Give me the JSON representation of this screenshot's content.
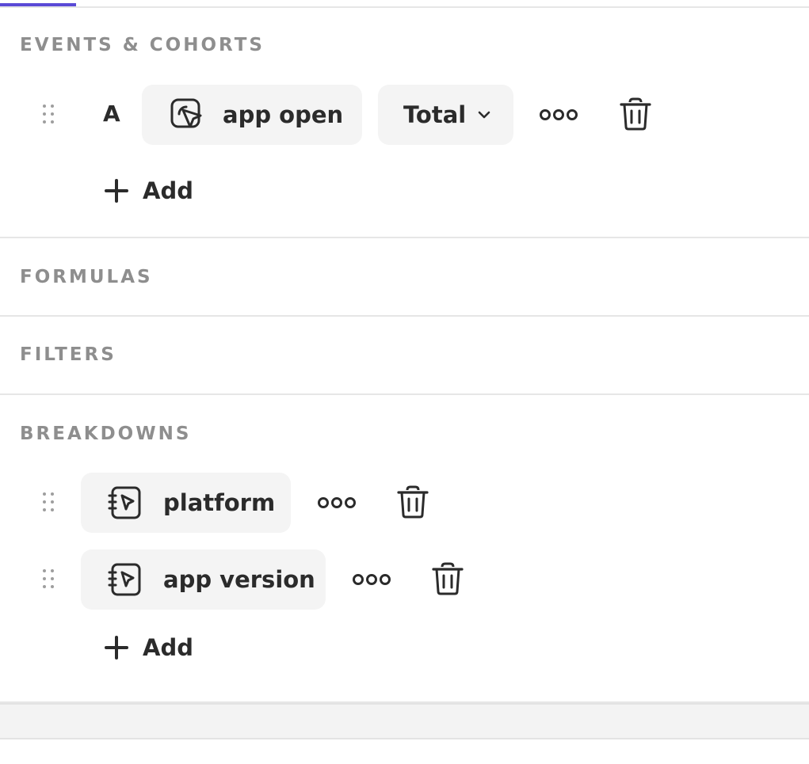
{
  "sections": {
    "events": {
      "title": "EVENTS & COHORTS"
    },
    "formulas": {
      "title": "FORMULAS"
    },
    "filters": {
      "title": "FILTERS"
    },
    "breakdowns": {
      "title": "BREAKDOWNS"
    }
  },
  "events": {
    "rows": [
      {
        "letter": "A",
        "event_label": "app open",
        "aggregation": "Total"
      }
    ],
    "add_label": "Add"
  },
  "breakdowns": {
    "rows": [
      {
        "label": "platform"
      },
      {
        "label": "app version"
      }
    ],
    "add_label": "Add"
  },
  "icons": {
    "drag": "drag-handle-icon",
    "event": "event-cursor-icon",
    "property": "property-cursor-icon",
    "more": "more-horizontal-icon",
    "trash": "trash-icon",
    "plus": "plus-icon",
    "chevron": "chevron-down-icon"
  },
  "colors": {
    "accent": "#5a4ad6",
    "chip_bg": "#f4f4f4",
    "section_title": "#8e8e8e"
  }
}
